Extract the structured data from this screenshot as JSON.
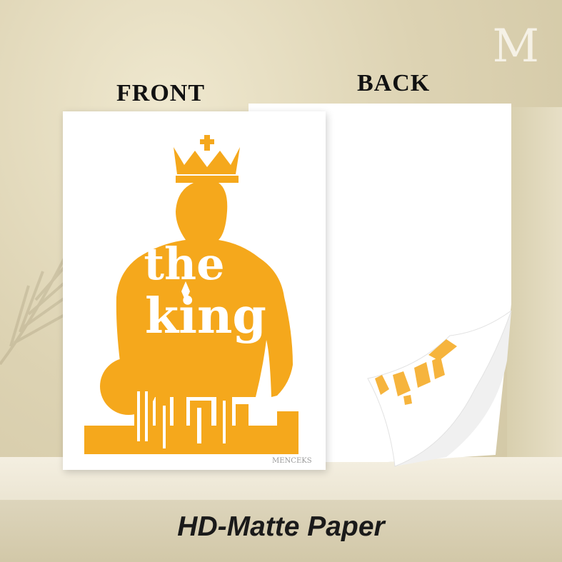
{
  "labels": {
    "front": "FRONT",
    "back": "BACK"
  },
  "logo": "M",
  "artwork": {
    "line1": "the",
    "line2": "king",
    "brand": "MENCEKS"
  },
  "title": "HD-Matte Paper",
  "colors": {
    "accent": "#f5a81c",
    "background": "#ddd3b3",
    "paper": "#ffffff"
  }
}
